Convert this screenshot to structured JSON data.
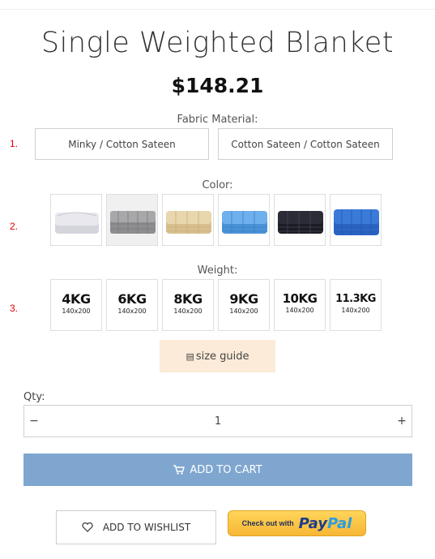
{
  "product": {
    "title": "Single Weighted Blanket",
    "price": "$148.21"
  },
  "fabric": {
    "label": "Fabric Material:",
    "marker": "1.",
    "options": [
      "Minky / Cotton Sateen",
      "Cotton Sateen / Cotton Sateen"
    ]
  },
  "color": {
    "label": "Color:",
    "marker": "2.",
    "swatches": [
      {
        "name": "white",
        "hex": "#e4e4ea"
      },
      {
        "name": "grey",
        "hex": "#9a9a9c"
      },
      {
        "name": "beige",
        "hex": "#e2cfa4"
      },
      {
        "name": "light-blue",
        "hex": "#5ea4e6"
      },
      {
        "name": "navy",
        "hex": "#24242e"
      },
      {
        "name": "blue",
        "hex": "#2f6fd2"
      }
    ]
  },
  "weight": {
    "label": "Weight:",
    "marker": "3.",
    "options": [
      {
        "value": "4KG",
        "size": "140x200"
      },
      {
        "value": "6KG",
        "size": "140x200"
      },
      {
        "value": "8KG",
        "size": "140x200"
      },
      {
        "value": "9KG",
        "size": "140x200"
      },
      {
        "value": "10KG",
        "size": "140x200"
      },
      {
        "value": "11.3KG",
        "size": "140x200"
      }
    ]
  },
  "size_guide": {
    "icon": "table-icon",
    "label": "size guide"
  },
  "quantity": {
    "label": "Qty:",
    "value": "1",
    "minus": "−",
    "plus": "+"
  },
  "cart": {
    "icon": "cart-icon",
    "label": "ADD TO CART",
    "color": "#7ea6cf"
  },
  "wishlist": {
    "icon": "heart-icon",
    "label": "ADD TO WISHLIST"
  },
  "paypal": {
    "prefix": "Check out with",
    "brand_a": "Pay",
    "brand_b": "Pal"
  },
  "colors": {
    "accent_button": "#7ea6cf",
    "size_guide_bg": "#fbebd8",
    "marker": "#e00000"
  }
}
